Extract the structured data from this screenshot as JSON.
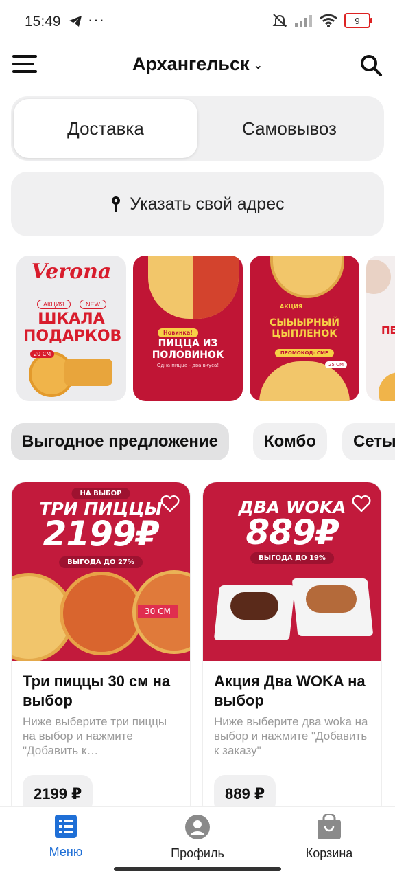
{
  "status_bar": {
    "time": "15:49",
    "battery": "9"
  },
  "header": {
    "city": "Архангельск"
  },
  "delivery_toggle": {
    "delivery": "Доставка",
    "pickup": "Самовывоз"
  },
  "address": {
    "label": "Указать свой адрес"
  },
  "stories": [
    {
      "brand": "Verona",
      "tag1": "АКЦИЯ",
      "tag2": "NEW",
      "title": "ШКАЛА ПОДАРКОВ",
      "badge": "20 СМ"
    },
    {
      "tag": "Новинка!",
      "title": "ПИЦЦА ИЗ ПОЛОВИНОК",
      "subtitle": "Одна пицца - два вкуса!"
    },
    {
      "tag": "АКЦИЯ",
      "title": "СЫЫЫРНЫЙ ЦЫПЛЕНОК",
      "promo": "ПРОМОКОД: CMP",
      "badge": "25 СМ"
    },
    {
      "title": "ПЕ"
    }
  ],
  "categories": [
    {
      "label": "Выгодное предложение",
      "active": true
    },
    {
      "label": "Комбо",
      "active": false
    },
    {
      "label": "Сеты",
      "active": false
    }
  ],
  "products": [
    {
      "banner_tag": "НА ВЫБОР",
      "banner_title": "ТРИ ПИЦЦЫ",
      "banner_price": "2199₽",
      "banner_saving": "ВЫГОДА ДО 27%",
      "banner_size": "30 СМ",
      "title": "Три пиццы 30 см на выбор",
      "description": "Ниже выберите три пиццы на выбор и нажмите \"Добавить к…",
      "price": "2199 ₽"
    },
    {
      "banner_title": "ДВА WOKA",
      "banner_price": "889₽",
      "banner_saving": "ВЫГОДА ДО 19%",
      "title": "Акция Два WOKA на выбор",
      "description": "Ниже выберите два woka на выбор и нажмите \"Добавить к заказу\"",
      "price": "889 ₽"
    }
  ],
  "bottom_nav": [
    {
      "label": "Меню",
      "icon": "menu-icon",
      "active": true,
      "color": "#1f6fd6"
    },
    {
      "label": "Профиль",
      "icon": "profile-icon",
      "active": false
    },
    {
      "label": "Корзина",
      "icon": "cart-icon",
      "active": false
    }
  ],
  "colors": {
    "brand_red": "#c21a3c",
    "accent_blue": "#1f6fd6",
    "chip_bg": "#f0f0f1"
  }
}
